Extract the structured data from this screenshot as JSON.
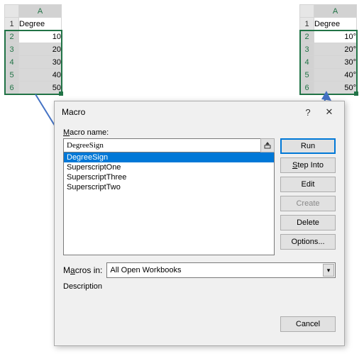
{
  "source_sheet": {
    "col_header": "A",
    "row1": {
      "n": "1",
      "v": "Degree"
    },
    "rows": [
      {
        "n": "2",
        "v": "10"
      },
      {
        "n": "3",
        "v": "20"
      },
      {
        "n": "4",
        "v": "30"
      },
      {
        "n": "5",
        "v": "40"
      },
      {
        "n": "6",
        "v": "50"
      }
    ]
  },
  "result_sheet": {
    "col_header": "A",
    "row1": {
      "n": "1",
      "v": "Degree"
    },
    "rows": [
      {
        "n": "2",
        "v": "10°"
      },
      {
        "n": "3",
        "v": "20°"
      },
      {
        "n": "4",
        "v": "30°"
      },
      {
        "n": "5",
        "v": "40°"
      },
      {
        "n": "6",
        "v": "50°"
      }
    ]
  },
  "dialog": {
    "title": "Macro",
    "help": "?",
    "close": "✕",
    "name_label": "Macro name:",
    "name_value": "DegreeSign",
    "list": [
      "DegreeSign",
      "SuperscriptOne",
      "SuperscriptThree",
      "SuperscriptTwo"
    ],
    "buttons": {
      "run": "Run",
      "step": "Step Into",
      "edit": "Edit",
      "create": "Create",
      "delete": "Delete",
      "options": "Options..."
    },
    "macros_in_label": "Macros in:",
    "macros_in_value": "All Open Workbooks",
    "description_label": "Description",
    "cancel": "Cancel"
  }
}
